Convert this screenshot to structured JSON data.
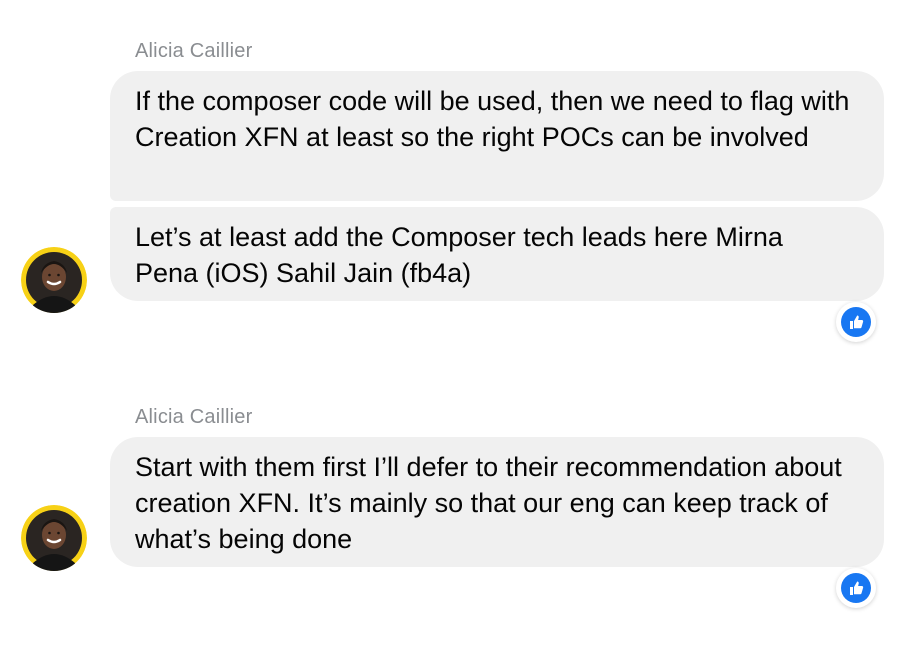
{
  "messages": [
    {
      "sender": "Alicia Caillier",
      "bubbles": [
        "If the composer code will be used, then we need to flag with Creation XFN at least so the right POCs can be involved",
        "Let’s at least add the Composer tech leads here Mirna Pena (iOS) Sahil Jain (fb4a)"
      ],
      "reaction": "like-icon"
    },
    {
      "sender": "Alicia Caillier",
      "bubbles": [
        "Start with them first I’ll defer to their recommendation about creation XFN. It’s mainly so that our eng can keep track of what’s being done"
      ],
      "reaction": "like-icon"
    }
  ],
  "colors": {
    "bubble": "#f0f0f0",
    "text": "#050505",
    "sender": "#8a8d91",
    "like": "#1877f2",
    "avatar_ring": "#f7d116"
  }
}
